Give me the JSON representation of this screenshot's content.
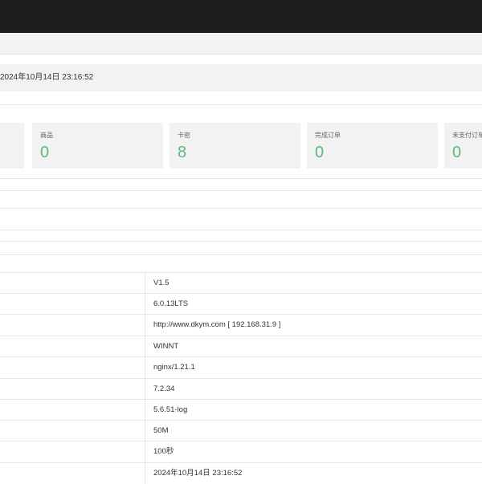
{
  "header": {
    "datetime": "2024年10月14日 23:16:52"
  },
  "stats": [
    {
      "label": "商品",
      "value": "0"
    },
    {
      "label": "卡密",
      "value": "8"
    },
    {
      "label": "完成订单",
      "value": "0"
    },
    {
      "label": "未支付订单",
      "value": "0"
    }
  ],
  "colors": {
    "accent": "#5fb878",
    "topbar": "#1e1e1e",
    "panel": "#f2f2f2"
  },
  "system_info": [
    {
      "value": "V1.5"
    },
    {
      "value": "6.0.13LTS"
    },
    {
      "value": "http://www.dkym.com [ 192.168.31.9 ]"
    },
    {
      "value": "WINNT"
    },
    {
      "value": "nginx/1.21.1"
    },
    {
      "value": "7.2.34"
    },
    {
      "value": "5.6.51-log"
    },
    {
      "value": "50M"
    },
    {
      "value": "100秒"
    },
    {
      "value": "2024年10月14日 23:16:52"
    }
  ]
}
